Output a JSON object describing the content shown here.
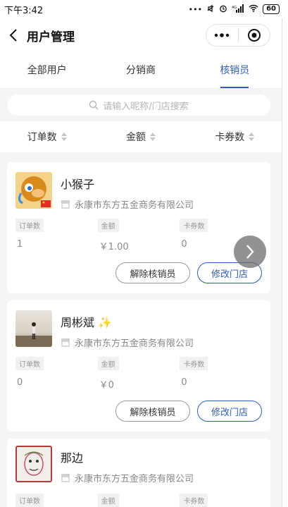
{
  "status_bar": {
    "time": "下午3:42",
    "signal": "4G",
    "battery": "60"
  },
  "nav": {
    "title": "用户管理"
  },
  "tabs": [
    {
      "label": "全部用户",
      "active": false
    },
    {
      "label": "分销商",
      "active": false
    },
    {
      "label": "核销员",
      "active": true
    }
  ],
  "search": {
    "placeholder": "请输入昵称/门店搜索"
  },
  "sort": [
    {
      "label": "订单数"
    },
    {
      "label": "金额"
    },
    {
      "label": "卡券数"
    }
  ],
  "cards": [
    {
      "name": "小猴子",
      "store": "永康市东方五金商务有限公司",
      "stats": [
        {
          "label": "订单数",
          "value": "1"
        },
        {
          "label": "金额",
          "value": "￥1.00"
        },
        {
          "label": "卡券数",
          "value": "0"
        }
      ],
      "buttons": {
        "remove": "解除核销员",
        "edit": "修改门店"
      }
    },
    {
      "name": "周彬斌",
      "name_emoji": "✨",
      "store": "永康市东方五金商务有限公司",
      "stats": [
        {
          "label": "订单数",
          "value": "0"
        },
        {
          "label": "金额",
          "value": "￥0"
        },
        {
          "label": "卡券数",
          "value": "0"
        }
      ],
      "buttons": {
        "remove": "解除核销员",
        "edit": "修改门店"
      }
    },
    {
      "name": "那边",
      "store": "永康市东方五金商务有限公司",
      "stats": [
        {
          "label": "订单数",
          "value": ""
        },
        {
          "label": "金额",
          "value": ""
        },
        {
          "label": "卡券数",
          "value": ""
        }
      ]
    }
  ],
  "colors": {
    "accent": "#2d5cc4",
    "background": "#f4f5f7"
  }
}
